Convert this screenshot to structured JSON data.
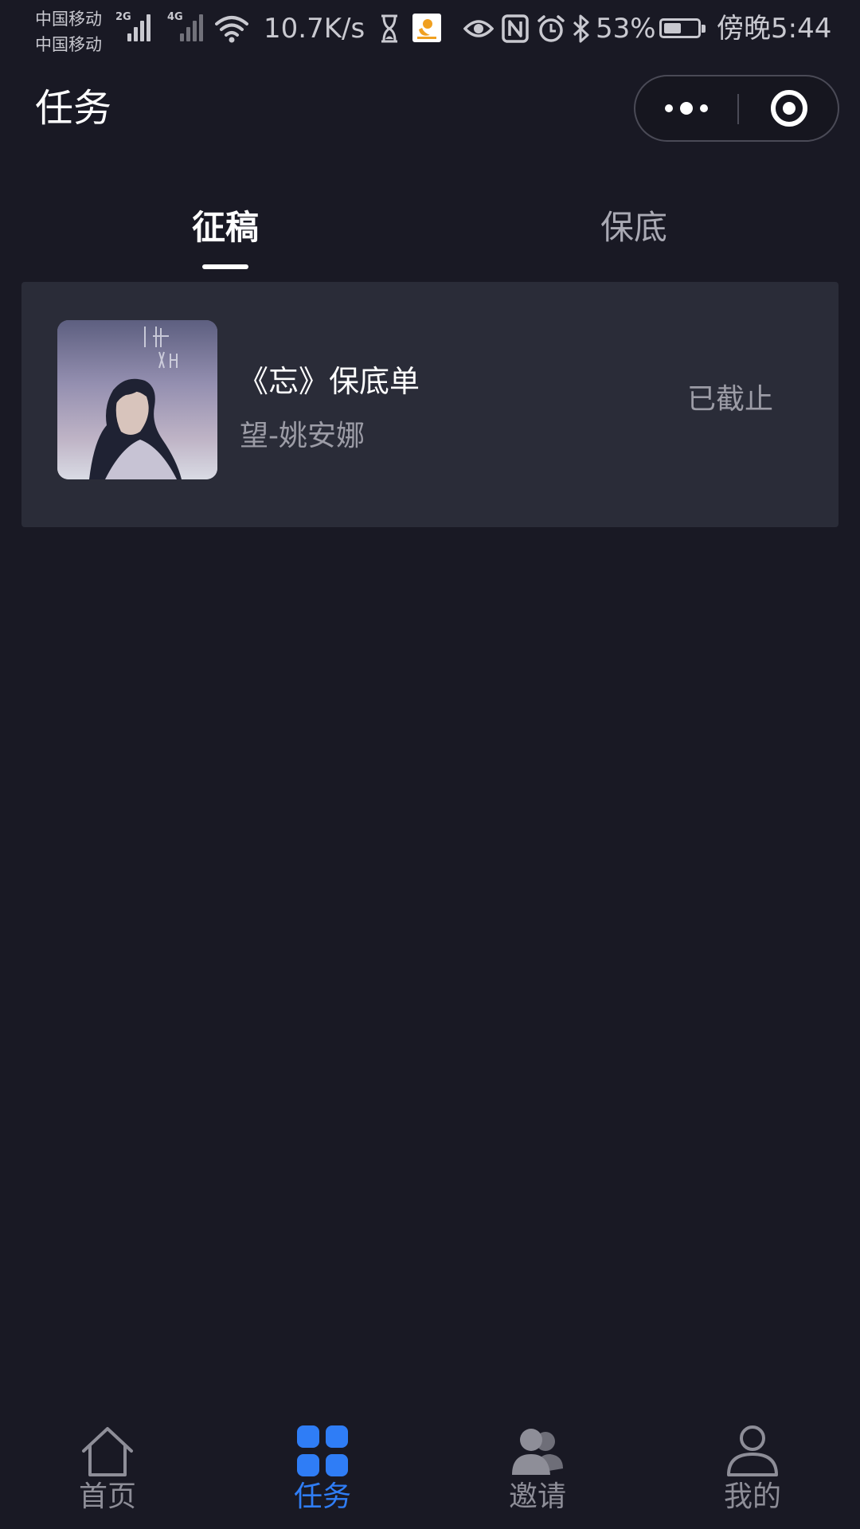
{
  "status_bar": {
    "carrier_1": "中国移动",
    "carrier_2": "中国移动",
    "network_1": "2G",
    "network_2": "4G",
    "net_speed": "10.7K/s",
    "battery_percent": "53%",
    "battery_level": 0.53,
    "time": "傍晚5:44"
  },
  "header": {
    "title": "任务"
  },
  "tabs": [
    {
      "label": "征稿",
      "active": true
    },
    {
      "label": "保底",
      "active": false
    }
  ],
  "task_card": {
    "title": "《忘》保底单",
    "subtitle": "望-姚安娜",
    "status": "已截止"
  },
  "bottom_nav": [
    {
      "label": "首页",
      "icon": "home-icon",
      "active": false
    },
    {
      "label": "任务",
      "icon": "grid-icon",
      "active": true
    },
    {
      "label": "邀请",
      "icon": "people-icon",
      "active": false
    },
    {
      "label": "我的",
      "icon": "person-icon",
      "active": false
    }
  ],
  "colors": {
    "background": "#191924",
    "card": "#2a2c38",
    "accent": "#2f7df6",
    "muted_text": "#9c9ca6"
  }
}
